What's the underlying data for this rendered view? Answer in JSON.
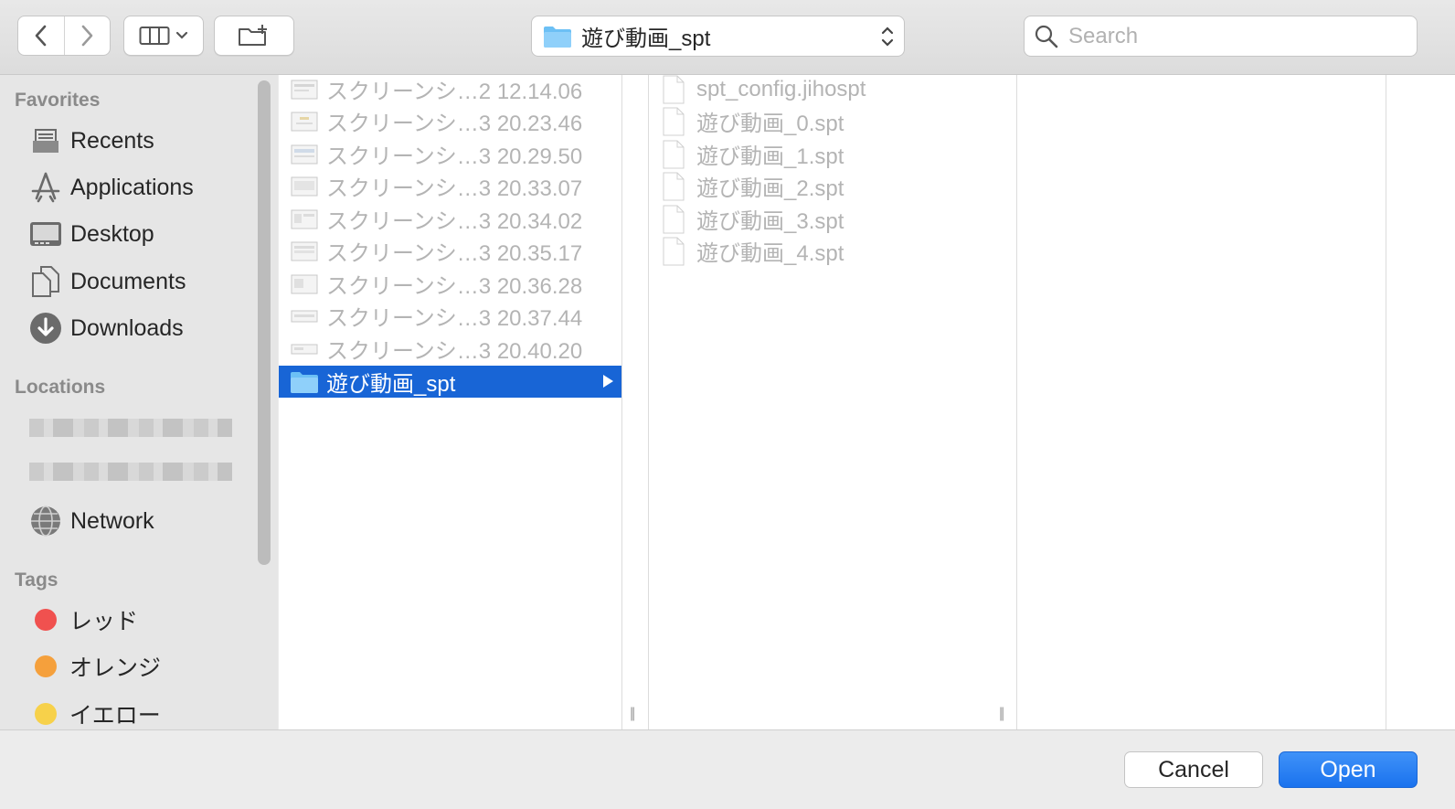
{
  "toolbar": {
    "back_icon": "chevron-left-icon",
    "forward_icon": "chevron-right-icon",
    "view_icon": "column-view-icon",
    "new_folder_icon": "new-folder-icon",
    "path_label": "遊び動画_spt",
    "search_placeholder": "Search"
  },
  "sidebar": {
    "favorites_title": "Favorites",
    "favorites": [
      {
        "label": "Recents",
        "icon": "recents-icon"
      },
      {
        "label": "Applications",
        "icon": "applications-icon"
      },
      {
        "label": "Desktop",
        "icon": "desktop-icon"
      },
      {
        "label": "Documents",
        "icon": "documents-icon"
      },
      {
        "label": "Downloads",
        "icon": "downloads-icon"
      }
    ],
    "locations_title": "Locations",
    "locations": [
      {
        "label": "Network",
        "icon": "network-icon"
      }
    ],
    "tags_title": "Tags",
    "tags": [
      {
        "label": "レッド",
        "color": "#f0514f"
      },
      {
        "label": "オレンジ",
        "color": "#f5a03c"
      },
      {
        "label": "イエロー",
        "color": "#f7d14a"
      }
    ]
  },
  "column1": {
    "items": [
      "スクリーンシ…2 12.14.06",
      "スクリーンシ…3 20.23.46",
      "スクリーンシ…3 20.29.50",
      "スクリーンシ…3 20.33.07",
      "スクリーンシ…3 20.34.02",
      "スクリーンシ…3 20.35.17",
      "スクリーンシ…3 20.36.28",
      "スクリーンシ…3 20.37.44",
      "スクリーンシ…3 20.40.20"
    ],
    "selected_folder": "遊び動画_spt"
  },
  "column2": {
    "items": [
      "spt_config.jihospt",
      "遊び動画_0.spt",
      "遊び動画_1.spt",
      "遊び動画_2.spt",
      "遊び動画_3.spt",
      "遊び動画_4.spt"
    ]
  },
  "bottom": {
    "cancel_label": "Cancel",
    "open_label": "Open"
  },
  "colors": {
    "selection": "#1865d6",
    "open_button": "#1a72ee",
    "folder": "#6cc0f5"
  }
}
